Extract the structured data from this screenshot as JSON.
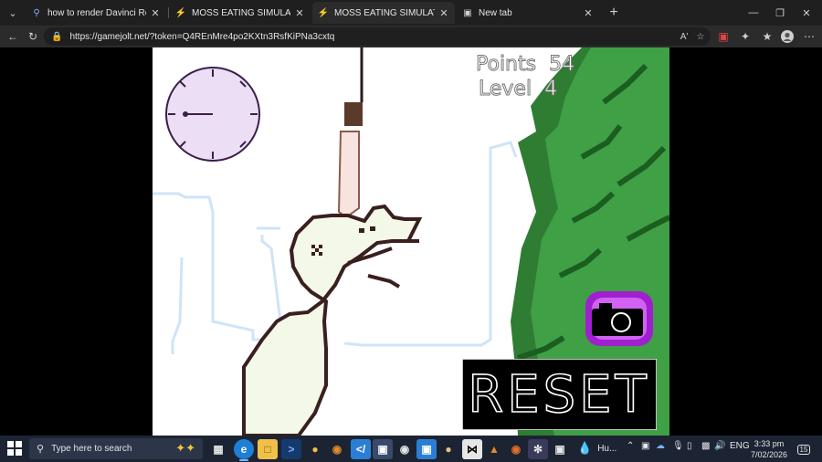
{
  "browser": {
    "tabs": [
      {
        "title": "how to render Davinci Resolve vid",
        "icon": "search-icon",
        "active": false
      },
      {
        "title": "MOSS EATING SIMULATOR by Att",
        "icon": "gamejolt-icon",
        "active": false
      },
      {
        "title": "MOSS EATING SIMULATOR - Gam",
        "icon": "gamejolt-icon",
        "active": true
      },
      {
        "title": "New tab",
        "icon": "newtab-icon",
        "active": false
      }
    ],
    "url": "https://gamejolt.net/?token=Q4REnMre4po2KXtn3RsfKiPNa3cxtq"
  },
  "game": {
    "points_label": "Points",
    "points_value": "54",
    "level_label": "Level",
    "level_value": "4",
    "reset_label": "RESET",
    "camera_icon": "camera-icon",
    "clock_icon": "clock-icon",
    "colors": {
      "moss_dark": "#2e7d32",
      "moss_light": "#3fa046",
      "creature_fill": "#f3f8e8",
      "creature_outline": "#3a1f1f",
      "clock_face": "#ecdff5",
      "camera_bg": "#a020d0",
      "reset_bg": "#000000"
    }
  },
  "taskbar": {
    "search_placeholder": "Type here to search",
    "weather_text": "Hu...",
    "language": "ENG",
    "time": "3:33 pm",
    "date": "7/02/2026",
    "notifications": "15"
  }
}
